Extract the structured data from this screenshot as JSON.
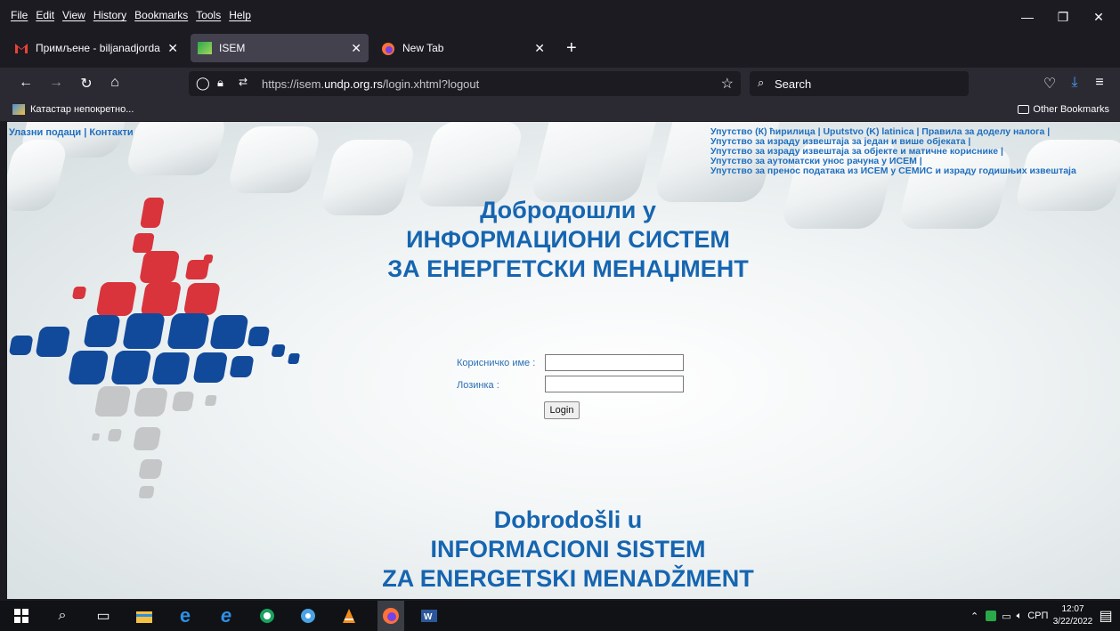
{
  "menubar": {
    "items": [
      "File",
      "Edit",
      "View",
      "History",
      "Bookmarks",
      "Tools",
      "Help"
    ],
    "controls": {
      "minimize": "—",
      "restore": "❐",
      "close": "✕"
    }
  },
  "tabs": [
    {
      "title": "Примљене - biljanadjordan@g",
      "icon": "gmail-icon",
      "active": false
    },
    {
      "title": "ISEM",
      "icon": "isem-favicon",
      "active": true
    },
    {
      "title": "New Tab",
      "icon": "firefox-icon",
      "active": false
    }
  ],
  "navbar": {
    "url_prefix": "https://isem.",
    "url_domain": "undp.org.rs",
    "url_path": "/login.xhtml?logout",
    "search_placeholder": "Search"
  },
  "bookmarks": {
    "item": "Катастар непокретно...",
    "other": "Other Bookmarks"
  },
  "page": {
    "left_links": [
      "Улазни подаци",
      "Контакти"
    ],
    "link_sep": " | ",
    "right_lines": [
      "Упутство (К) ћирилица | Uputstvo (K) latinica | Правила за доделу налога |",
      "Упутство за израду извештаја за један и више објеката |",
      "Упутство за израду извештаја за објекте и матичне кориснике |",
      "Упутство за аутоматски унос рачуна у ИСЕМ |",
      "Упутство за пренос података из ИСЕМ у СЕМИС и израду годишњих извештаја"
    ],
    "welcome_cyr": [
      "Добродошли у",
      "ИНФОРМАЦИОНИ СИСТЕМ",
      "ЗА ЕНЕРГЕТСКИ МЕНАЏМЕНТ"
    ],
    "welcome_lat": [
      "Dobrodošli u",
      "INFORMACIONI SISTEM",
      "ZA ENERGETSKI MENADŽMENT"
    ],
    "login": {
      "username_label": "Корисничко име :",
      "password_label": "Лозинка :",
      "button": "Login",
      "username_value": "",
      "password_value": ""
    }
  },
  "taskbar": {
    "apps": [
      "windows-start-icon",
      "search-icon",
      "task-view-icon",
      "file-explorer-icon",
      "edge-icon",
      "internet-explorer-icon",
      "chrome-like-icon",
      "security-icon",
      "vlc-icon",
      "firefox-icon",
      "word-icon"
    ],
    "language": "СРП",
    "time": "12:07",
    "date": "3/22/2022"
  },
  "colors": {
    "accent": "#1665b0",
    "link": "#1f6fbf",
    "logo_red": "#d9343c",
    "logo_blue": "#114a9b",
    "logo_gray": "#c4c6c8"
  }
}
